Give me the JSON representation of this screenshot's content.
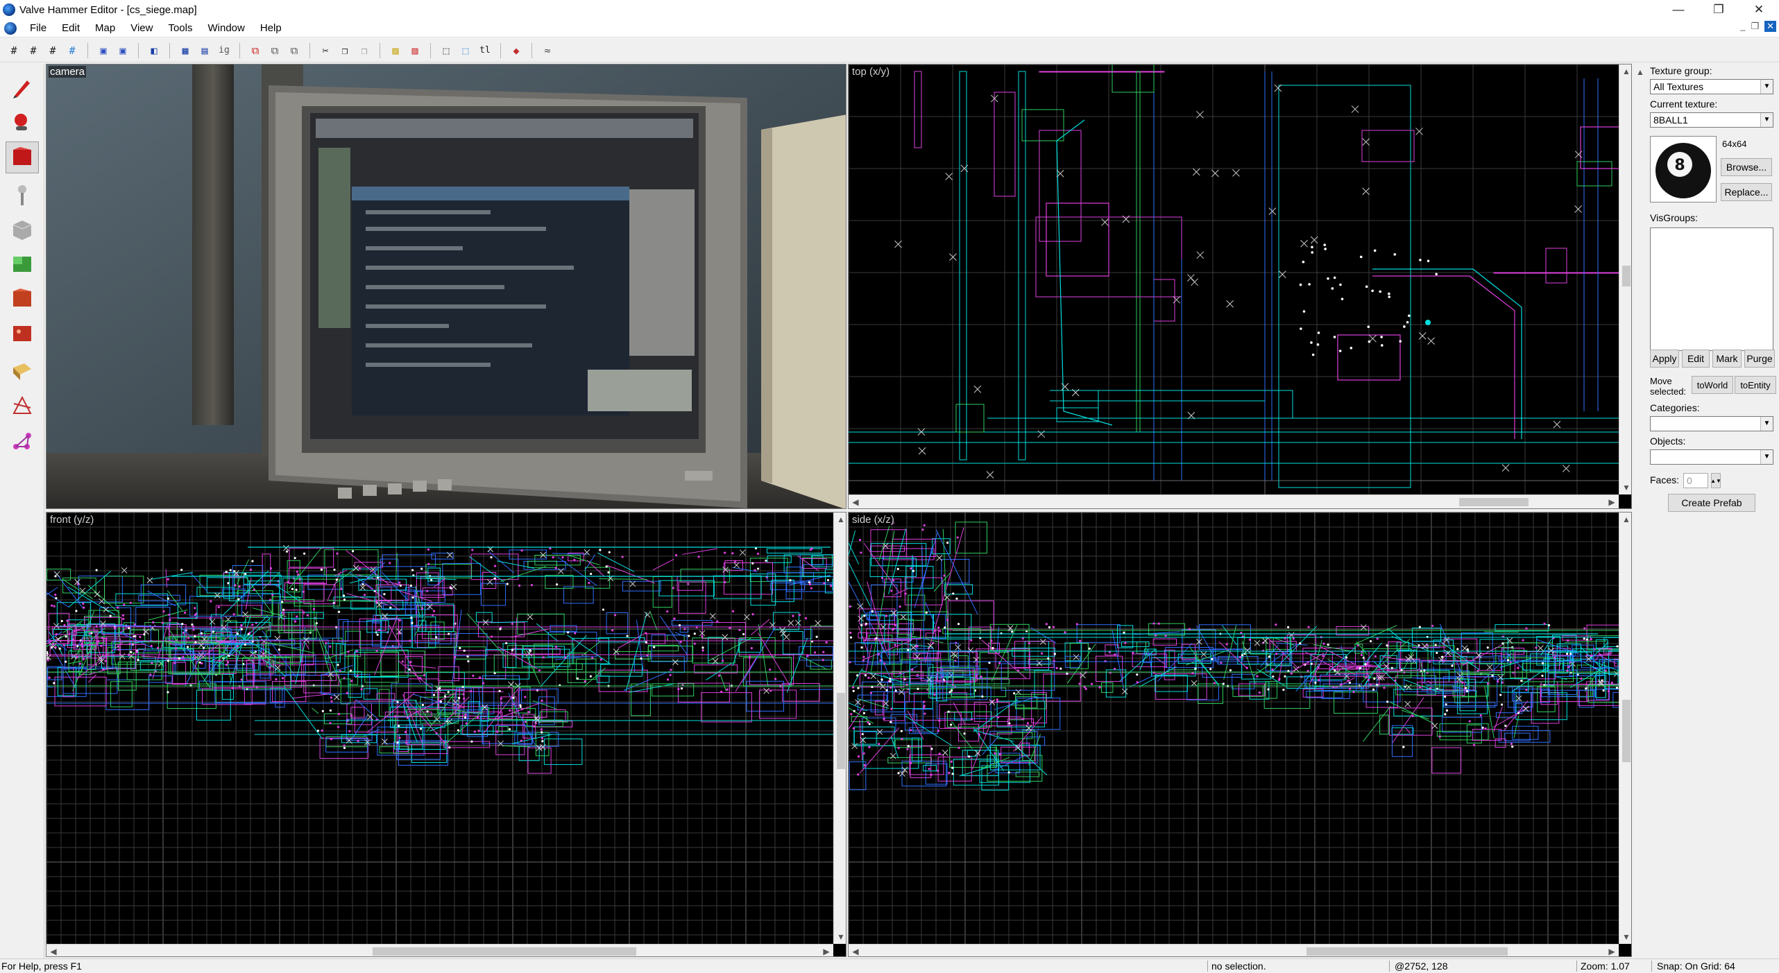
{
  "window": {
    "title": "Valve Hammer Editor - [cs_siege.map]",
    "controls": {
      "minimize": "—",
      "maximize": "❐",
      "close": "✕"
    }
  },
  "menu": {
    "items": [
      "File",
      "Edit",
      "Map",
      "View",
      "Tools",
      "Window",
      "Help"
    ],
    "mdi_controls": {
      "minimize": "_",
      "restore": "❐",
      "close": "✕"
    }
  },
  "toolbar": {
    "buttons": [
      "grid-toggle-icon",
      "grid-3d-icon",
      "grid-smaller-icon",
      "grid-larger-icon",
      "texture-lock-icon",
      "texture-scale-icon",
      "undo-icon",
      "group-icon",
      "ungroup-icon",
      "ignore-groups-icon",
      "hide-selected-icon",
      "hide-unselected-icon",
      "show-all-icon",
      "cut-icon",
      "copy-icon",
      "paste-icon",
      "carve-icon",
      "hollow-icon",
      "toggle-select-handles-icon",
      "toggle-texture-app-icon",
      "texture-lock-text-icon",
      "clip-icon",
      "vertex-icon"
    ],
    "ig_label": "ig",
    "tl_label": "tl"
  },
  "tools": [
    "selection-tool-icon",
    "magnify-tool-icon",
    "camera-tool-icon",
    "entity-tool-icon",
    "block-tool-icon",
    "texture-application-icon",
    "apply-current-texture-icon",
    "decal-tool-icon",
    "overlay-tool-icon",
    "clipping-tool-icon",
    "vertex-manipulation-icon",
    "path-tool-icon"
  ],
  "viewports": {
    "camera": {
      "label": "camera"
    },
    "top": {
      "label": "top (x/y)"
    },
    "front": {
      "label": "front (y/z)"
    },
    "side": {
      "label": "side (x/z)"
    }
  },
  "sidepanel": {
    "texture_group_label": "Texture group:",
    "texture_group_value": "All Textures",
    "current_texture_label": "Current texture:",
    "current_texture_value": "8BALL1",
    "texture_size": "64x64",
    "browse_label": "Browse...",
    "replace_label": "Replace...",
    "visgroups_label": "VisGroups:",
    "apply_label": "Apply",
    "edit_label": "Edit",
    "mark_label": "Mark",
    "purge_label": "Purge",
    "move_selected_label": "Move selected:",
    "to_world_label": "toWorld",
    "to_entity_label": "toEntity",
    "categories_label": "Categories:",
    "categories_value": "",
    "objects_label": "Objects:",
    "objects_value": "",
    "faces_label": "Faces:",
    "faces_value": "0",
    "create_prefab_label": "Create Prefab",
    "texture_ball_number": "8"
  },
  "status": {
    "help": "For Help, press F1",
    "selection": "no selection.",
    "coords": "@2752, 128",
    "zoom": "Zoom: 1.07",
    "snap": "Snap: On Grid: 64"
  },
  "colors": {
    "grid_minor": "#3a3a3a",
    "grid_major": "#6a6a6a",
    "brush_cyan": "#00e0e0",
    "brush_magenta": "#e040e0",
    "brush_green": "#30d060",
    "brush_blue": "#3070ff",
    "vertex_white": "#ffffff"
  }
}
